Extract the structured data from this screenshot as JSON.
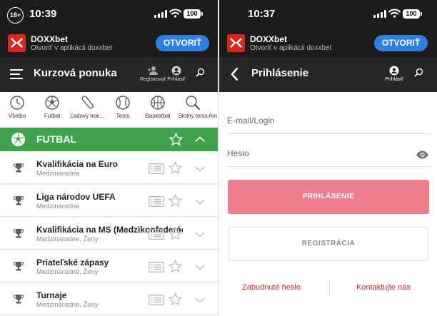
{
  "age_badge": "18+",
  "left": {
    "status": {
      "time": "10:39",
      "battery": "100"
    },
    "banner": {
      "name": "DOXXbet",
      "subtitle": "Otvoriť v aplikácii doxxbet",
      "open_label": "OTVORIŤ"
    },
    "header": {
      "title": "Kurzová ponuka",
      "actions": [
        {
          "label": "Registrovať",
          "icon": "person-add-icon"
        },
        {
          "label": "Prihlásiť",
          "icon": "account-icon"
        },
        {
          "label": "",
          "icon": "search-icon"
        }
      ]
    },
    "sports": [
      {
        "label": "Všetko",
        "icon": "clock-icon"
      },
      {
        "label": "Futbal",
        "icon": "soccer-ball-icon"
      },
      {
        "label": "Ľadový hok...",
        "icon": "hockey-stick-icon"
      },
      {
        "label": "Tenis",
        "icon": "tennis-ball-icon"
      },
      {
        "label": "Basketbal",
        "icon": "basketball-icon"
      },
      {
        "label": "Stolný tenis",
        "icon": "table-tennis-icon"
      },
      {
        "label": "Am",
        "icon": ""
      }
    ],
    "section": {
      "title": "FUTBAL"
    },
    "competitions": [
      {
        "name": "Kvalifikácia na Euro",
        "sub": "Medzinárodne"
      },
      {
        "name": "Liga národov UEFA",
        "sub": "Medzinárodne"
      },
      {
        "name": "Kvalifikácia na MS (Medzikonfederácia)",
        "sub": "Medzinárodne, Ženy"
      },
      {
        "name": "Priateľské zápasy",
        "sub": "Medzinárodne, Ženy"
      },
      {
        "name": "Turnaje",
        "sub": "Medzinárodne, Ženy"
      }
    ]
  },
  "right": {
    "status": {
      "time": "10:37",
      "battery": "100"
    },
    "banner": {
      "name": "DOXXbet",
      "subtitle": "Otvoriť v aplikácii doxxbet",
      "open_label": "OTVORIŤ"
    },
    "header": {
      "title": "Prihlásenie",
      "actions": [
        {
          "label": "Prihlásiť",
          "icon": "account-icon"
        },
        {
          "label": "",
          "icon": "search-icon"
        }
      ]
    },
    "form": {
      "email_placeholder": "E-mail/Login",
      "password_placeholder": "Heslo",
      "login_label": "PRIHLÁSENIE",
      "register_label": "REGISTRÁCIA",
      "forgot_label": "Zabudnuté heslo",
      "contact_label": "Kontaktujte nás"
    }
  },
  "colors": {
    "accent_green": "#3ea34a",
    "brand_red": "#d42a1f",
    "button_blue": "#2f7fe0",
    "login_pink": "#ee7f8d",
    "dark_bar": "#262626"
  }
}
